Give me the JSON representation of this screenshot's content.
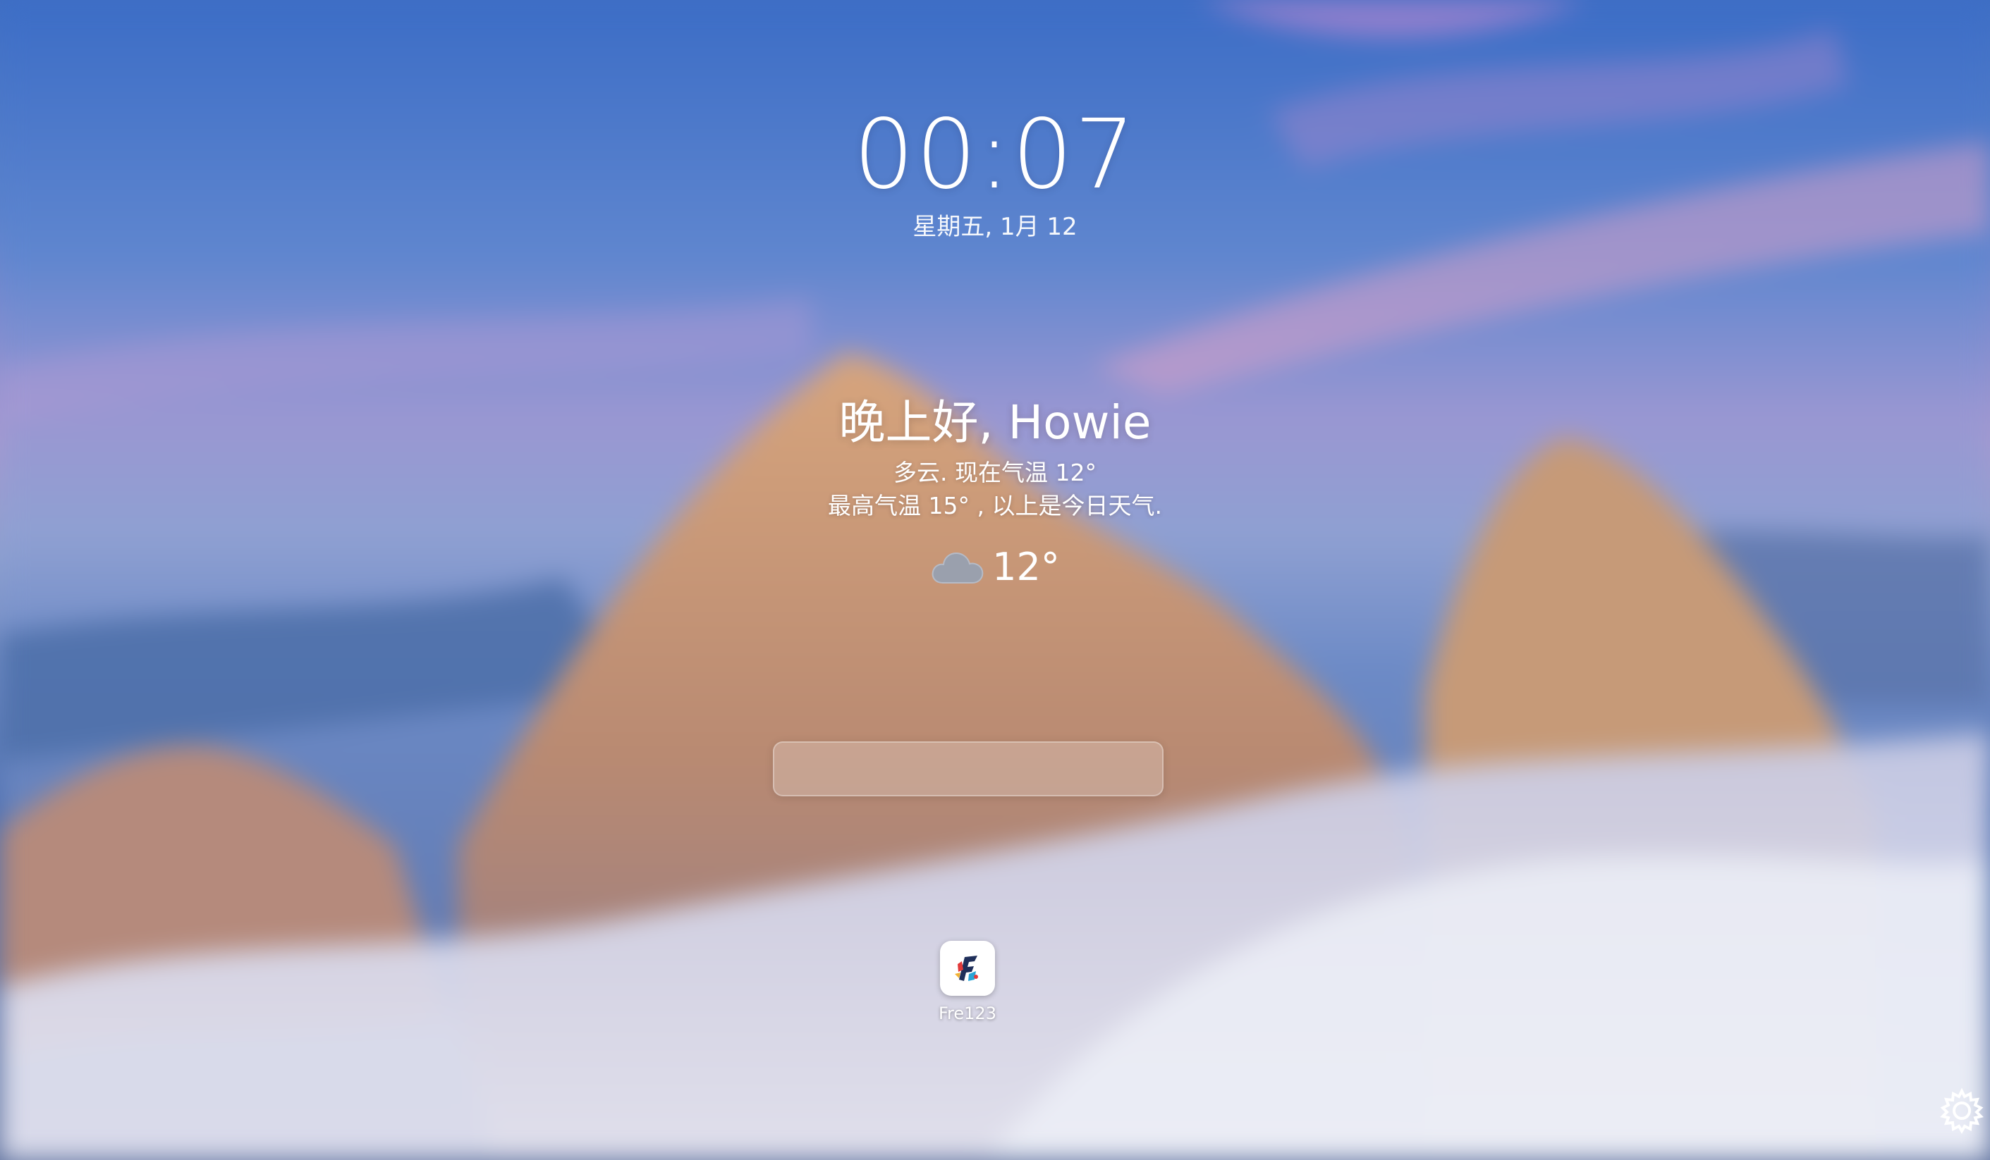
{
  "clock": {
    "time": "00:07",
    "date": "星期五, 1月 12"
  },
  "greeting": {
    "text": "晚上好, Howie",
    "weather_line1": "多云. 现在气温 12°",
    "weather_line2": "最高气温 15° , 以上是今日天气.",
    "current_temp": "12°",
    "weather_icon": "cloud-icon"
  },
  "search": {
    "value": "",
    "placeholder": ""
  },
  "apps": [
    {
      "label": "Fre123",
      "icon": "fre123-app-icon"
    }
  ],
  "settings": {
    "icon": "gear-icon"
  },
  "colors": {
    "text": "#ffffff",
    "sky_top": "#3f6fc4",
    "sky_pink": "#c98bd0",
    "rock": "#c79a74",
    "snow": "#d9dcef"
  }
}
